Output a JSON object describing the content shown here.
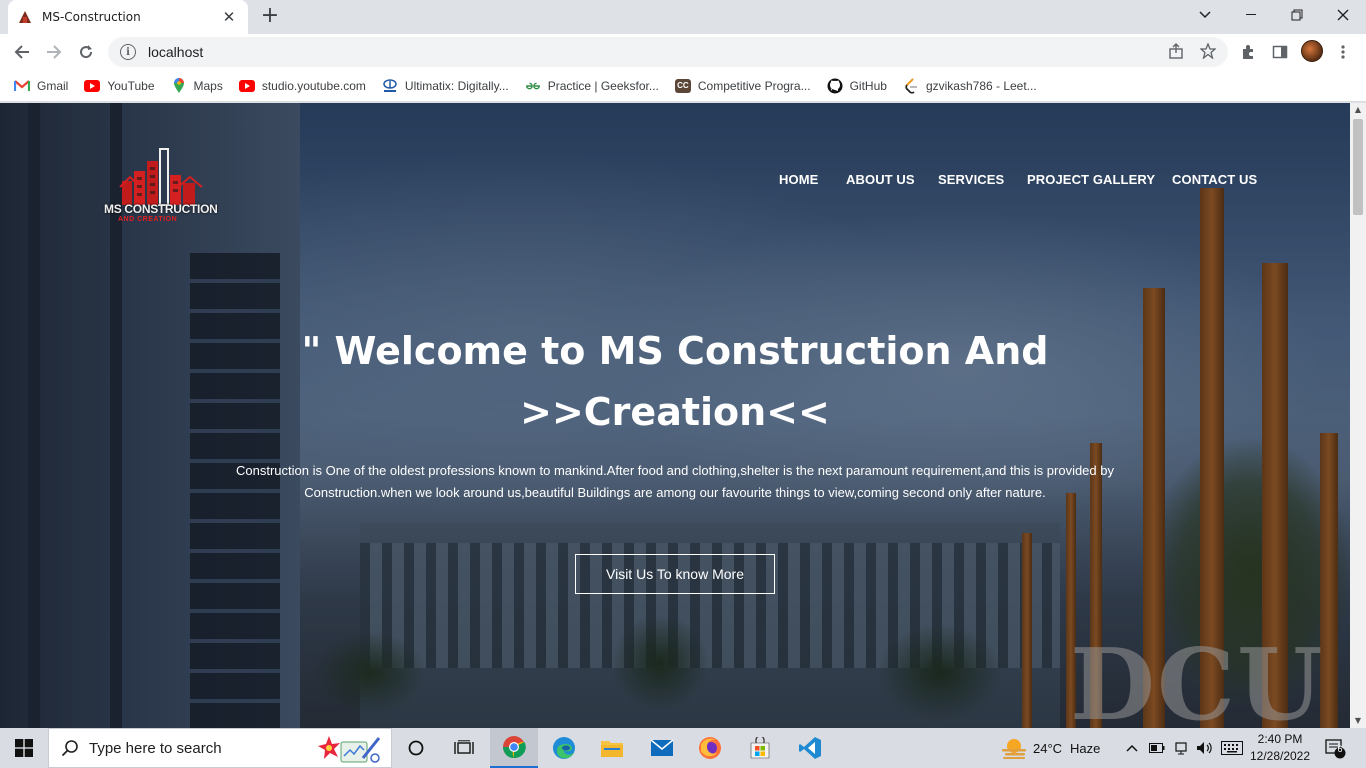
{
  "browser": {
    "tab_title": "MS-Construction",
    "url": "localhost",
    "new_tab_label": "+",
    "close_tab_label": "✕"
  },
  "bookmarks": [
    {
      "label": "Gmail",
      "icon": "gmail-icon",
      "color": "#ea4335"
    },
    {
      "label": "YouTube",
      "icon": "youtube-icon",
      "color": "#ff0000"
    },
    {
      "label": "Maps",
      "icon": "maps-icon",
      "color": "#34a853"
    },
    {
      "label": "studio.youtube.com",
      "icon": "youtube-studio-icon",
      "color": "#ff0000"
    },
    {
      "label": "Ultimatix: Digitally...",
      "icon": "tata-icon",
      "color": "#1f5aa6"
    },
    {
      "label": "Practice | Geeksfor...",
      "icon": "geeksforgeeks-icon",
      "color": "#2f8d46"
    },
    {
      "label": "Competitive Progra...",
      "icon": "codechef-icon",
      "color": "#5b4638"
    },
    {
      "label": "GitHub",
      "icon": "github-icon",
      "color": "#000000"
    },
    {
      "label": "gzvikash786 - Leet...",
      "icon": "leetcode-icon",
      "color": "#ffa116"
    }
  ],
  "site": {
    "logo_text": "MS CONSTRUCTION",
    "logo_subtext": "AND CREATION",
    "nav": [
      "HOME",
      "ABOUT US",
      "SERVICES",
      "PROJECT GALLERY",
      "CONTACT US"
    ],
    "hero_title_line1": "\" Welcome to MS Construction And",
    "hero_title_line2": ">>Creation<<",
    "hero_desc_line1": "Construction is One of the oldest professions known to mankind.After food and clothing,shelter is the next paramount requirement,and this is provided by",
    "hero_desc_line2": "Construction.when we look around us,beautiful Buildings are among our favourite things to view,coming second only after nature.",
    "hero_button": "Visit Us To know More",
    "background_sign": "DCU"
  },
  "taskbar": {
    "search_placeholder": "Type here to search",
    "weather_temp": "24°C",
    "weather_desc": "Haze",
    "time": "2:40 PM",
    "date": "12/28/2022",
    "notification_count": "6"
  },
  "colors": {
    "accent_red": "#e02020",
    "taskbar_bg": "#d9dde3",
    "chrome_tab_bg": "#dee1e6"
  }
}
